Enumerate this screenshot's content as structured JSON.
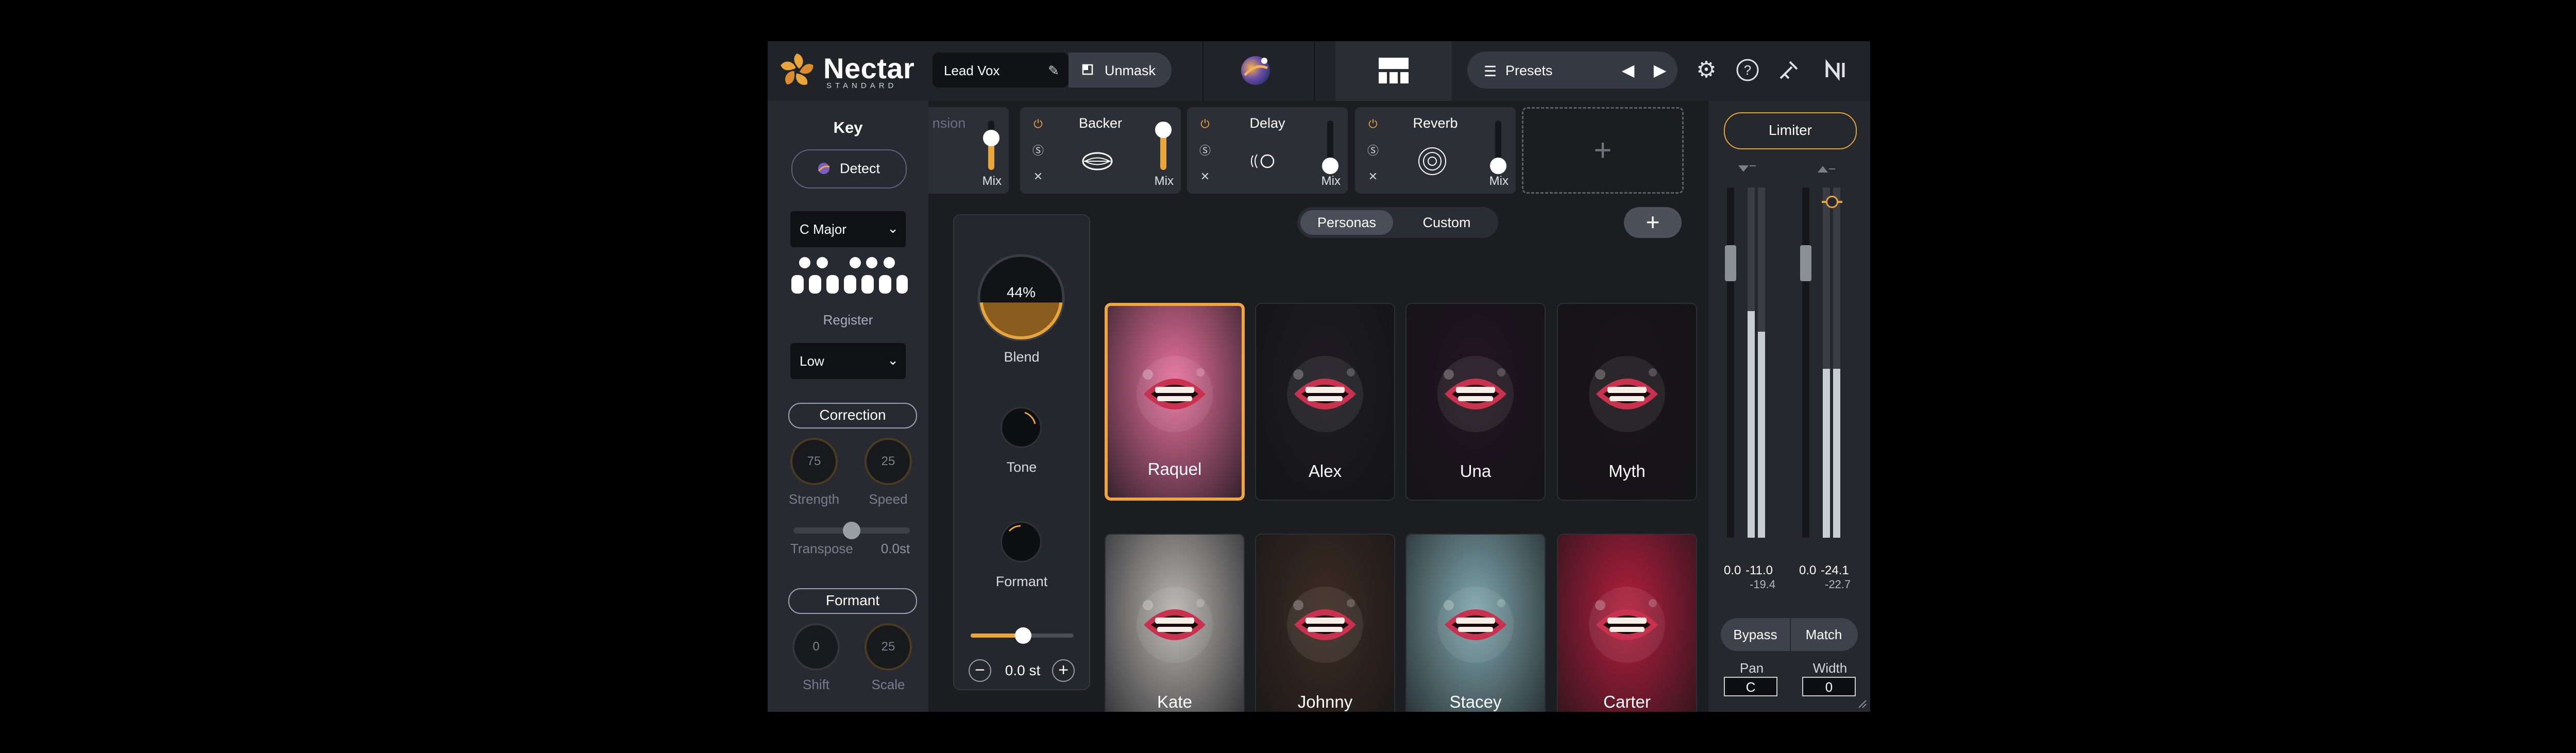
{
  "app": {
    "name": "Nectar",
    "edition": "STANDARD"
  },
  "topbar": {
    "track_name": "Lead Vox",
    "unmask_label": "Unmask",
    "presets_label": "Presets",
    "presets_icon": "list-icon",
    "icons": [
      "settings-gear-icon",
      "help-icon",
      "wrench-icon",
      "ni-logo-icon"
    ]
  },
  "key_panel": {
    "title": "Key",
    "detect_label": "Detect",
    "key_value": "C Major",
    "register_label": "Register",
    "register_value": "Low",
    "correction_label": "Correction",
    "strength_value": "75",
    "strength_label": "Strength",
    "speed_value": "25",
    "speed_label": "Speed",
    "transpose_label": "Transpose",
    "transpose_value": "0.0st",
    "formant_label": "Formant",
    "shift_value": "0",
    "shift_label": "Shift",
    "scale_value": "25",
    "scale_label": "Scale"
  },
  "modules": [
    {
      "name": "",
      "partial_name": "nsion",
      "mix_label": "Mix",
      "mix": 0.55
    },
    {
      "name": "Backer",
      "mix_label": "Mix",
      "mix": 0.85
    },
    {
      "name": "Delay",
      "mix_label": "Mix",
      "mix": 0.2
    },
    {
      "name": "Reverb",
      "mix_label": "Mix",
      "mix": 0.2
    }
  ],
  "persona": {
    "tab_personas": "Personas",
    "tab_custom": "Custom",
    "blend_value": "44%",
    "blend_percent": 44,
    "blend_label": "Blend",
    "tone_label": "Tone",
    "formant_label": "Formant",
    "pitch_value": "0.0 st",
    "cards": [
      {
        "name": "Raquel",
        "selected": true,
        "bg": "#e8719b"
      },
      {
        "name": "Alex",
        "selected": false,
        "bg": "#1e1c22"
      },
      {
        "name": "Una",
        "selected": false,
        "bg": "#221520"
      },
      {
        "name": "Myth",
        "selected": false,
        "bg": "#1a1417"
      },
      {
        "name": "Kate",
        "selected": false,
        "bg": "#b9b6b3"
      },
      {
        "name": "Johnny",
        "selected": false,
        "bg": "#3d2c22"
      },
      {
        "name": "Stacey",
        "selected": false,
        "bg": "#7fa8ae"
      },
      {
        "name": "Carter",
        "selected": false,
        "bg": "#b31e3c"
      }
    ]
  },
  "right_panel": {
    "limiter_label": "Limiter",
    "meters_left": {
      "peak": "0.0",
      "val": "-11.0",
      "sub": "-19.4"
    },
    "meters_right": {
      "peak": "0.0",
      "val": "-24.1",
      "sub": "-22.7"
    },
    "bypass_label": "Bypass",
    "match_label": "Match",
    "pan_label": "Pan",
    "pan_value": "C",
    "width_label": "Width",
    "width_value": "0"
  },
  "colors": {
    "accent": "#e8a53c",
    "panel": "#272a30",
    "background": "#1b1d21"
  }
}
